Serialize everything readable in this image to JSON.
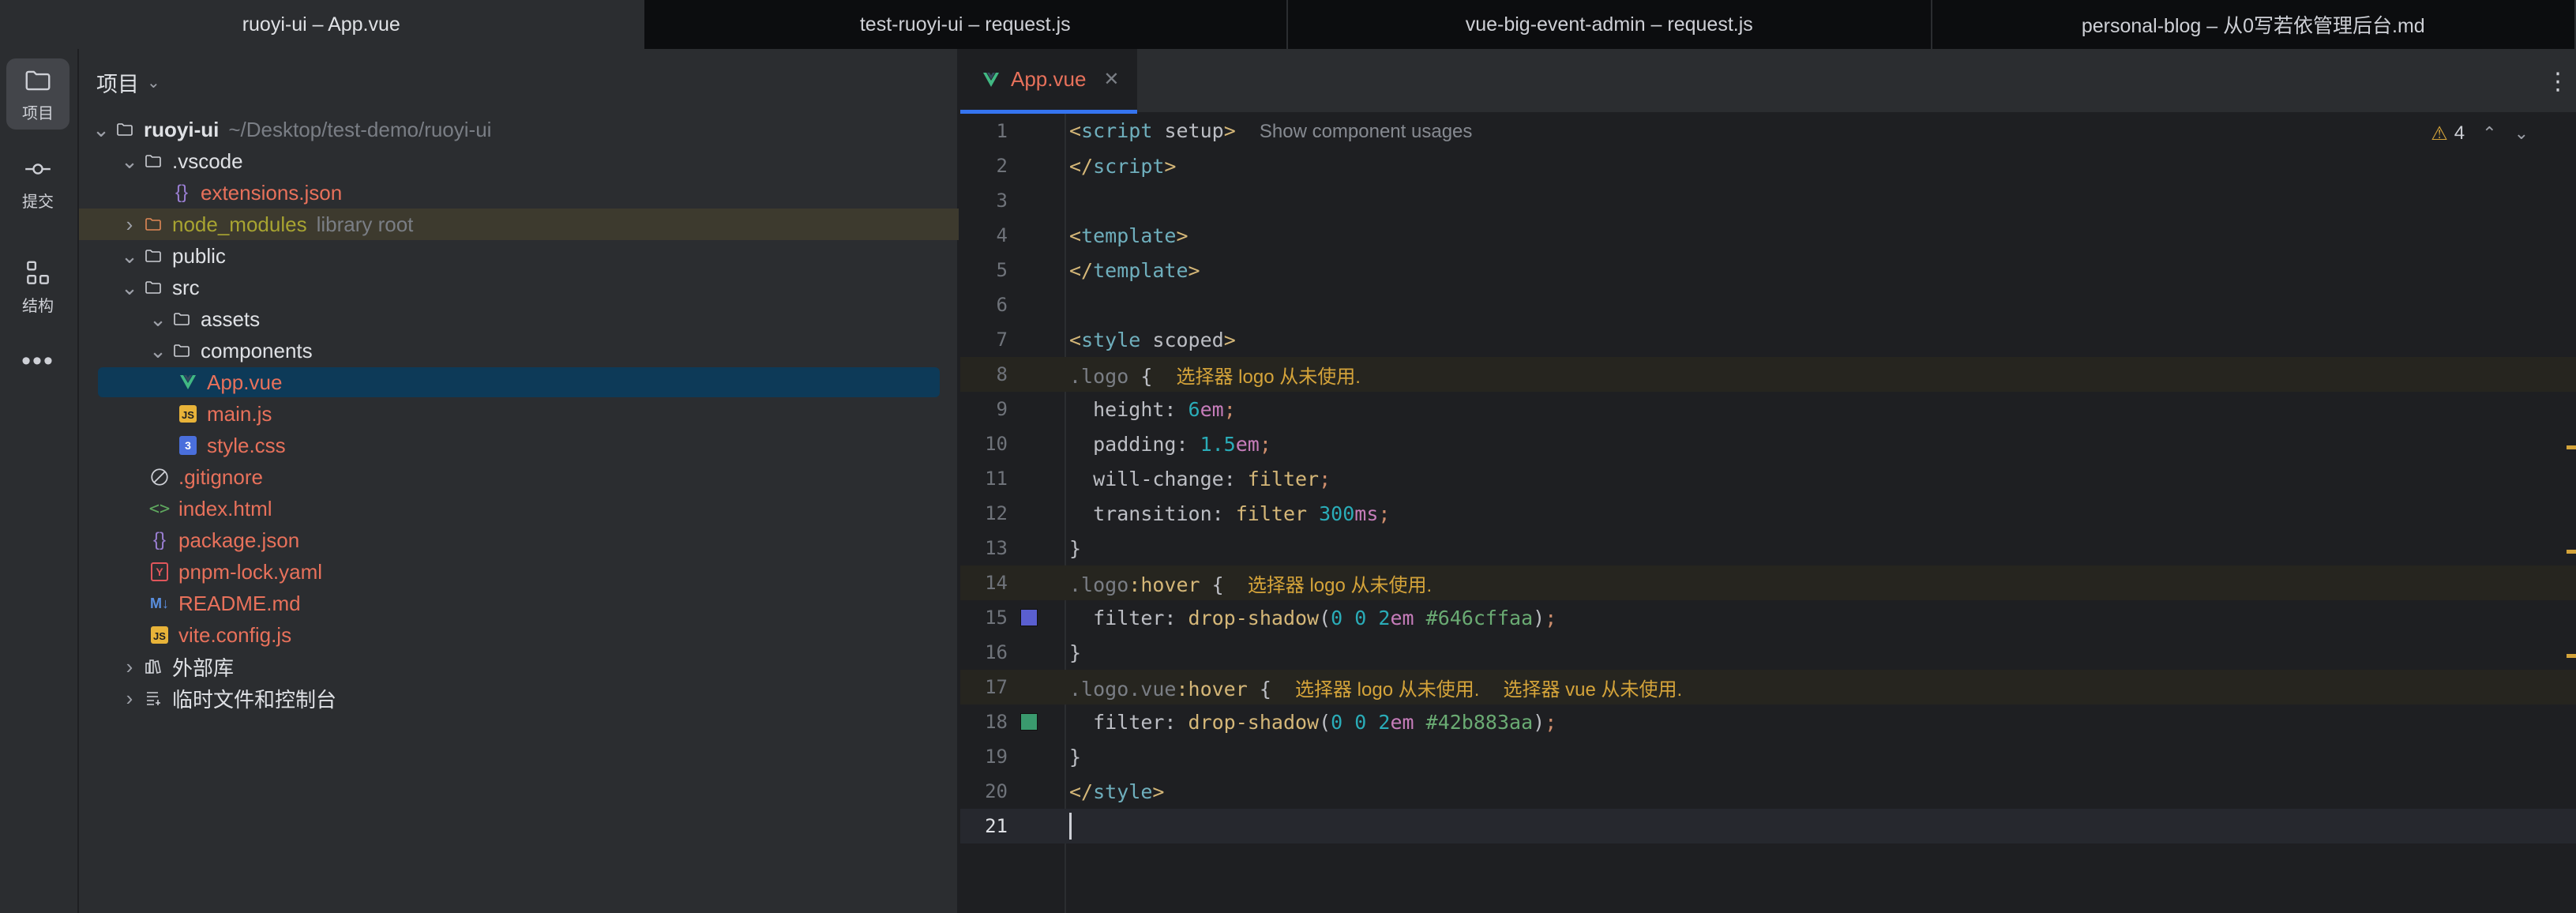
{
  "window_tabs": [
    {
      "label": "ruoyi-ui – App.vue",
      "active": true
    },
    {
      "label": "test-ruoyi-ui – request.js",
      "active": false
    },
    {
      "label": "vue-big-event-admin – request.js",
      "active": false
    },
    {
      "label": "personal-blog – 从0写若依管理后台.md",
      "active": false
    }
  ],
  "activity_bar": {
    "project_label": "项目",
    "commit_label": "提交",
    "structure_label": "结构",
    "more_icon": "more-icon"
  },
  "project_panel": {
    "title": "项目",
    "root_name": "ruoyi-ui",
    "root_path": "~/Desktop/test-demo/ruoyi-ui",
    "vscode": ".vscode",
    "extensions_json": "extensions.json",
    "node_modules": "node_modules",
    "node_modules_hint": "library root",
    "public": "public",
    "src": "src",
    "assets": "assets",
    "components": "components",
    "app_vue": "App.vue",
    "main_js": "main.js",
    "style_css": "style.css",
    "gitignore": ".gitignore",
    "index_html": "index.html",
    "package_json": "package.json",
    "pnpm_lock": "pnpm-lock.yaml",
    "readme": "README.md",
    "vite_config": "vite.config.js",
    "external_libs": "外部库",
    "scratches": "临时文件和控制台"
  },
  "editor": {
    "tab_label": "App.vue",
    "warning_count": "4",
    "inlay_usages": "Show component usages",
    "warn_logo": "选择器 logo 从未使用.",
    "warn_vue": "选择器 vue 从未使用.",
    "line_numbers": [
      "1",
      "2",
      "3",
      "4",
      "5",
      "6",
      "7",
      "8",
      "9",
      "10",
      "11",
      "12",
      "13",
      "14",
      "15",
      "16",
      "17",
      "18",
      "19",
      "20",
      "21"
    ],
    "colors": {
      "swatch_line15": "#646cff",
      "swatch_line18": "#42b883"
    }
  }
}
